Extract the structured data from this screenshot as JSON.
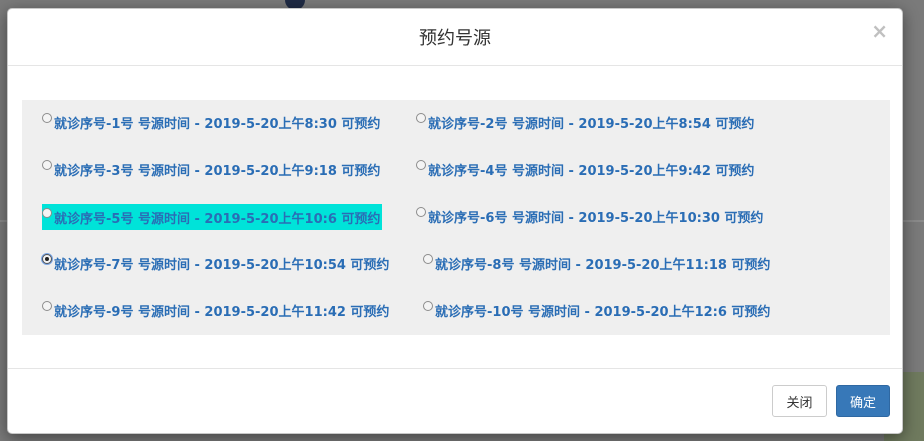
{
  "modal": {
    "title": "预约号源",
    "close_symbol": "×"
  },
  "slots": [
    {
      "label": "就诊序号-1号 号源时间 - 2019-5-20上午8:30 可预约",
      "checked": false,
      "highlighted": false
    },
    {
      "label": "就诊序号-2号 号源时间 - 2019-5-20上午8:54 可预约",
      "checked": false,
      "highlighted": false
    },
    {
      "label": "就诊序号-3号 号源时间 - 2019-5-20上午9:18 可预约",
      "checked": false,
      "highlighted": false
    },
    {
      "label": "就诊序号-4号 号源时间 - 2019-5-20上午9:42 可预约",
      "checked": false,
      "highlighted": false
    },
    {
      "label": "就诊序号-5号 号源时间 - 2019-5-20上午10:6 可预约",
      "checked": false,
      "highlighted": true
    },
    {
      "label": "就诊序号-6号 号源时间 - 2019-5-20上午10:30 可预约",
      "checked": false,
      "highlighted": false
    },
    {
      "label": "就诊序号-7号 号源时间 - 2019-5-20上午10:54 可预约",
      "checked": true,
      "highlighted": false
    },
    {
      "label": "就诊序号-8号 号源时间 - 2019-5-20上午11:18 可预约",
      "checked": false,
      "highlighted": false
    },
    {
      "label": "就诊序号-9号 号源时间 - 2019-5-20上午11:42 可预约",
      "checked": false,
      "highlighted": false
    },
    {
      "label": "就诊序号-10号 号源时间 - 2019-5-20上午12:6 可预约",
      "checked": false,
      "highlighted": false
    }
  ],
  "footer": {
    "close_label": "关闭",
    "confirm_label": "确定"
  },
  "colors": {
    "slot_text": "#2a6db5",
    "highlight": "#00e3d9",
    "confirm_button": "#3778b8"
  }
}
